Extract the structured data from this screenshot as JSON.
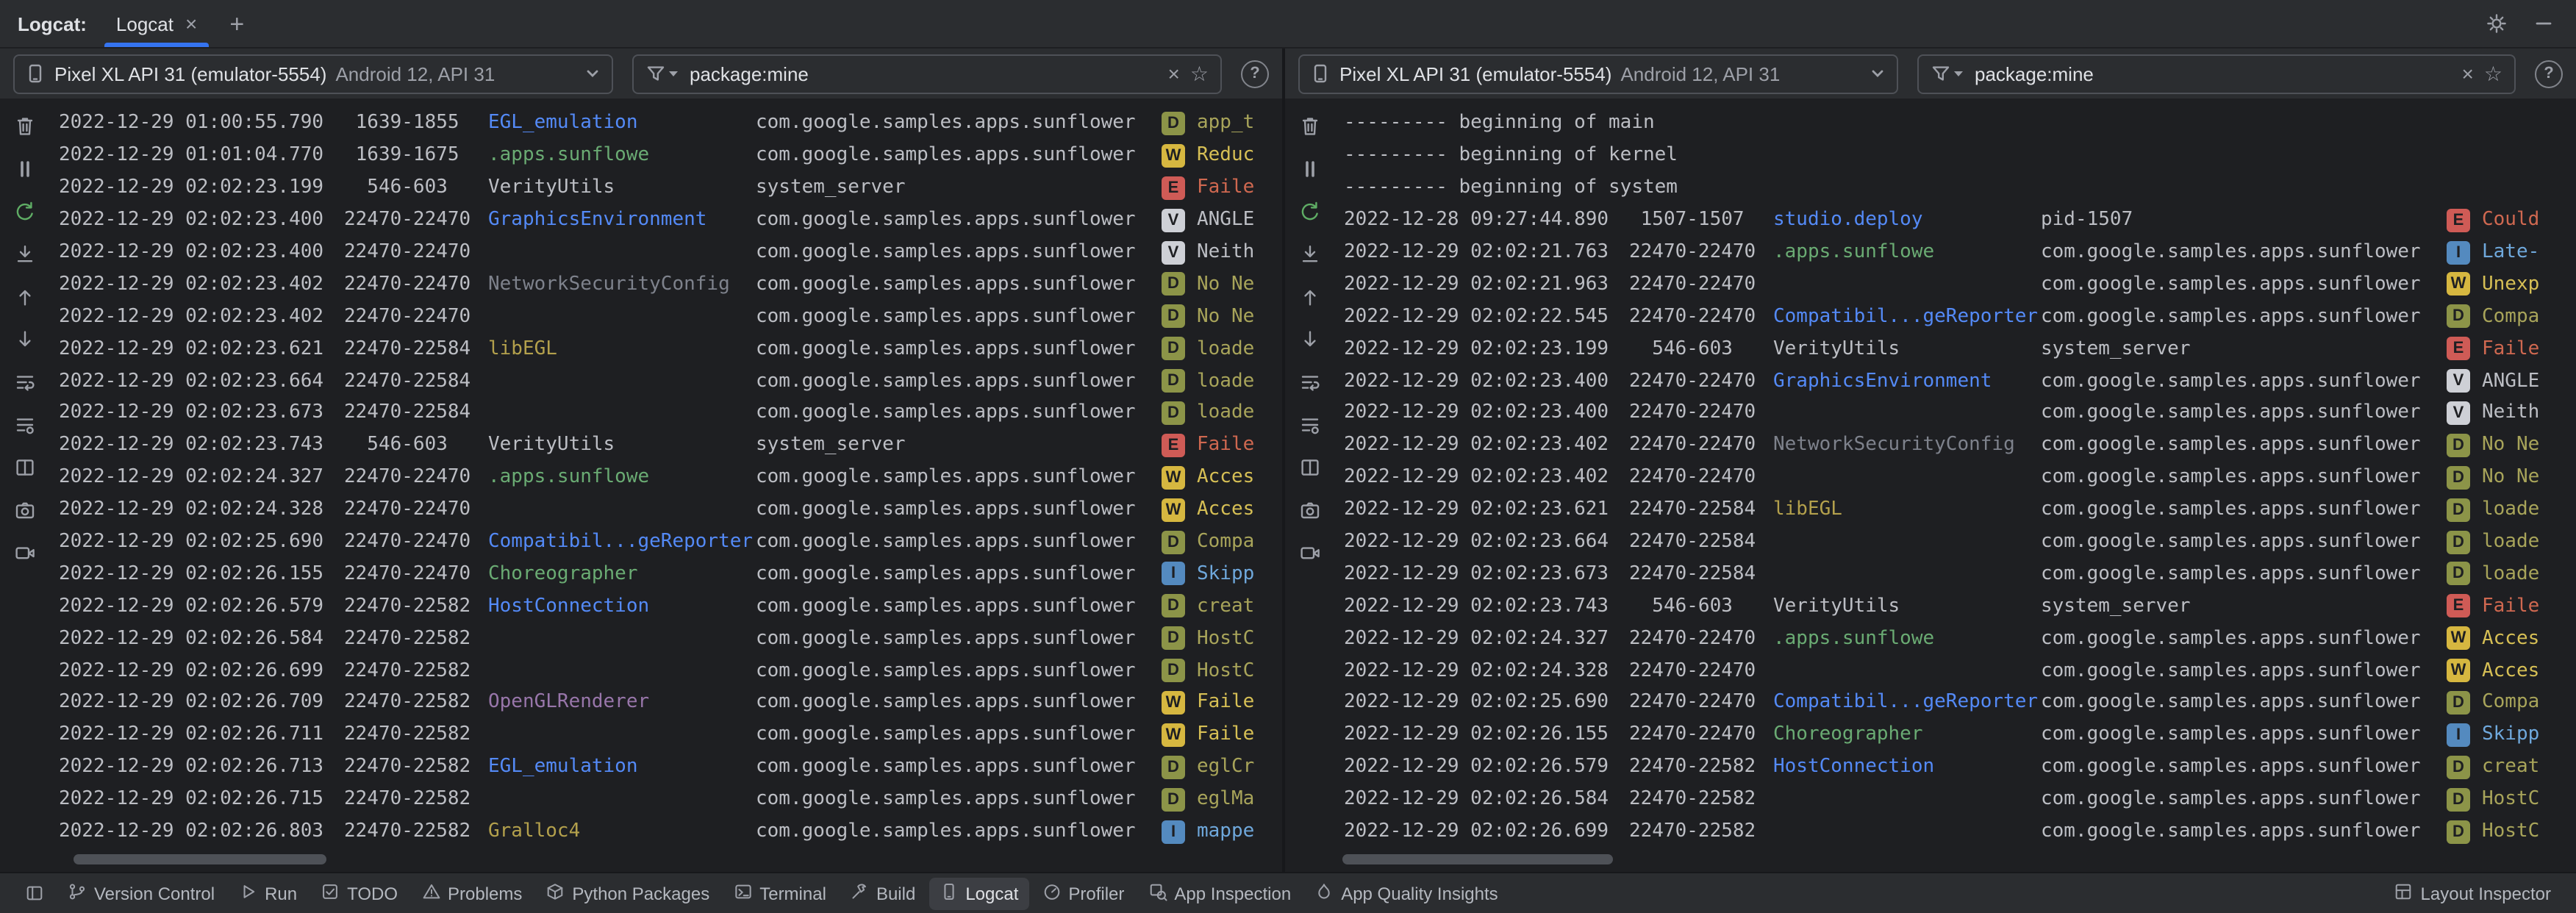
{
  "header": {
    "tool_label": "Logcat:",
    "tab_label": "Logcat",
    "close_glyph": "×",
    "add_glyph": "+",
    "right_icons": [
      "settings-gear",
      "hide-tool-window"
    ]
  },
  "controls": {
    "clear": "×",
    "favorite": "☆",
    "help": "?"
  },
  "palette": {
    "accent": "#3574F0",
    "chrome_bg": "#2B2D30",
    "content_bg": "#1E1F22",
    "levels": {
      "V": {
        "badge": "#CED0D6",
        "text": "#BCBEC4"
      },
      "D": {
        "badge": "#8C9448",
        "text": "#A8A45A"
      },
      "I": {
        "badge": "#548ABF",
        "text": "#6FA8DC"
      },
      "W": {
        "badge": "#D6B740",
        "text": "#D6BF55"
      },
      "E": {
        "badge": "#CF5B56",
        "text": "#CF6850"
      }
    },
    "tags": {
      "blue": "#548AF7",
      "green": "#6AAB73",
      "yellow": "#B3A04C",
      "gray": "#7E828C",
      "purple": "#9876AA",
      "default": "#BCBEC4"
    }
  },
  "side_toolbar": [
    "clear-logcat",
    "pause-logcat",
    "restart-logcat",
    "scroll-to-end",
    "previous-occurrence",
    "next-occurrence",
    "soft-wrap",
    "configure-logcat-options",
    "split-panels",
    "take-screenshot",
    "record-screen"
  ],
  "panes": [
    {
      "device_name": "Pixel XL API 31 (emulator-5554)",
      "device_detail": "Android 12, API 31",
      "filter": "package:mine",
      "rows": [
        {
          "t": "2022-12-29 01:00:55.790",
          "p": " 1639-1855",
          "tag": "EGL_emulation",
          "tc": "blue",
          "pkg": "com.google.samples.apps.sunflower",
          "l": "D",
          "m": "app_t"
        },
        {
          "t": "2022-12-29 01:01:04.770",
          "p": " 1639-1675",
          "tag": ".apps.sunflowe",
          "tc": "green",
          "pkg": "com.google.samples.apps.sunflower",
          "l": "W",
          "m": "Reduc"
        },
        {
          "t": "2022-12-29 02:02:23.199",
          "p": "  546-603",
          "tag": "VerityUtils",
          "tc": "default",
          "pkg": "system_server",
          "l": "E",
          "m": "Faile"
        },
        {
          "t": "2022-12-29 02:02:23.400",
          "p": "22470-22470",
          "tag": "GraphicsEnvironment",
          "tc": "blue",
          "pkg": "com.google.samples.apps.sunflower",
          "l": "V",
          "m": "ANGLE"
        },
        {
          "t": "2022-12-29 02:02:23.400",
          "p": "22470-22470",
          "tag": "",
          "tc": "default",
          "pkg": "com.google.samples.apps.sunflower",
          "l": "V",
          "m": "Neith"
        },
        {
          "t": "2022-12-29 02:02:23.402",
          "p": "22470-22470",
          "tag": "NetworkSecurityConfig",
          "tc": "gray",
          "pkg": "com.google.samples.apps.sunflower",
          "l": "D",
          "m": "No Ne"
        },
        {
          "t": "2022-12-29 02:02:23.402",
          "p": "22470-22470",
          "tag": "",
          "tc": "default",
          "pkg": "com.google.samples.apps.sunflower",
          "l": "D",
          "m": "No Ne"
        },
        {
          "t": "2022-12-29 02:02:23.621",
          "p": "22470-22584",
          "tag": "libEGL",
          "tc": "yellow",
          "pkg": "com.google.samples.apps.sunflower",
          "l": "D",
          "m": "loade"
        },
        {
          "t": "2022-12-29 02:02:23.664",
          "p": "22470-22584",
          "tag": "",
          "tc": "default",
          "pkg": "com.google.samples.apps.sunflower",
          "l": "D",
          "m": "loade"
        },
        {
          "t": "2022-12-29 02:02:23.673",
          "p": "22470-22584",
          "tag": "",
          "tc": "default",
          "pkg": "com.google.samples.apps.sunflower",
          "l": "D",
          "m": "loade"
        },
        {
          "t": "2022-12-29 02:02:23.743",
          "p": "  546-603",
          "tag": "VerityUtils",
          "tc": "default",
          "pkg": "system_server",
          "l": "E",
          "m": "Faile"
        },
        {
          "t": "2022-12-29 02:02:24.327",
          "p": "22470-22470",
          "tag": ".apps.sunflowe",
          "tc": "green",
          "pkg": "com.google.samples.apps.sunflower",
          "l": "W",
          "m": "Acces"
        },
        {
          "t": "2022-12-29 02:02:24.328",
          "p": "22470-22470",
          "tag": "",
          "tc": "default",
          "pkg": "com.google.samples.apps.sunflower",
          "l": "W",
          "m": "Acces"
        },
        {
          "t": "2022-12-29 02:02:25.690",
          "p": "22470-22470",
          "tag": "Compatibil...geReporter",
          "tc": "blue",
          "pkg": "com.google.samples.apps.sunflower",
          "l": "D",
          "m": "Compa"
        },
        {
          "t": "2022-12-29 02:02:26.155",
          "p": "22470-22470",
          "tag": "Choreographer",
          "tc": "green",
          "pkg": "com.google.samples.apps.sunflower",
          "l": "I",
          "m": "Skipp"
        },
        {
          "t": "2022-12-29 02:02:26.579",
          "p": "22470-22582",
          "tag": "HostConnection",
          "tc": "blue",
          "pkg": "com.google.samples.apps.sunflower",
          "l": "D",
          "m": "creat"
        },
        {
          "t": "2022-12-29 02:02:26.584",
          "p": "22470-22582",
          "tag": "",
          "tc": "default",
          "pkg": "com.google.samples.apps.sunflower",
          "l": "D",
          "m": "HostC"
        },
        {
          "t": "2022-12-29 02:02:26.699",
          "p": "22470-22582",
          "tag": "",
          "tc": "default",
          "pkg": "com.google.samples.apps.sunflower",
          "l": "D",
          "m": "HostC"
        },
        {
          "t": "2022-12-29 02:02:26.709",
          "p": "22470-22582",
          "tag": "OpenGLRenderer",
          "tc": "purple",
          "pkg": "com.google.samples.apps.sunflower",
          "l": "W",
          "m": "Faile"
        },
        {
          "t": "2022-12-29 02:02:26.711",
          "p": "22470-22582",
          "tag": "",
          "tc": "default",
          "pkg": "com.google.samples.apps.sunflower",
          "l": "W",
          "m": "Faile"
        },
        {
          "t": "2022-12-29 02:02:26.713",
          "p": "22470-22582",
          "tag": "EGL_emulation",
          "tc": "blue",
          "pkg": "com.google.samples.apps.sunflower",
          "l": "D",
          "m": "eglCr"
        },
        {
          "t": "2022-12-29 02:02:26.715",
          "p": "22470-22582",
          "tag": "",
          "tc": "default",
          "pkg": "com.google.samples.apps.sunflower",
          "l": "D",
          "m": "eglMa"
        },
        {
          "t": "2022-12-29 02:02:26.803",
          "p": "22470-22582",
          "tag": "Gralloc4",
          "tc": "yellow",
          "pkg": "com.google.samples.apps.sunflower",
          "l": "I",
          "m": "mappe"
        }
      ]
    },
    {
      "device_name": "Pixel XL API 31 (emulator-5554)",
      "device_detail": "Android 12, API 31",
      "filter": "package:mine",
      "rows": [
        {
          "sp": "--------- beginning of main"
        },
        {
          "sp": "--------- beginning of kernel"
        },
        {
          "sp": "--------- beginning of system"
        },
        {
          "t": "2022-12-28 09:27:44.890",
          "p": " 1507-1507",
          "tag": "studio.deploy",
          "tc": "blue",
          "pkg": "pid-1507",
          "l": "E",
          "m": "Could"
        },
        {
          "t": "2022-12-29 02:02:21.763",
          "p": "22470-22470",
          "tag": ".apps.sunflowe",
          "tc": "green",
          "pkg": "com.google.samples.apps.sunflower",
          "l": "I",
          "m": "Late-"
        },
        {
          "t": "2022-12-29 02:02:21.963",
          "p": "22470-22470",
          "tag": "",
          "tc": "default",
          "pkg": "com.google.samples.apps.sunflower",
          "l": "W",
          "m": "Unexp"
        },
        {
          "t": "2022-12-29 02:02:22.545",
          "p": "22470-22470",
          "tag": "Compatibil...geReporter",
          "tc": "blue",
          "pkg": "com.google.samples.apps.sunflower",
          "l": "D",
          "m": "Compa"
        },
        {
          "t": "2022-12-29 02:02:23.199",
          "p": "  546-603",
          "tag": "VerityUtils",
          "tc": "default",
          "pkg": "system_server",
          "l": "E",
          "m": "Faile"
        },
        {
          "t": "2022-12-29 02:02:23.400",
          "p": "22470-22470",
          "tag": "GraphicsEnvironment",
          "tc": "blue",
          "pkg": "com.google.samples.apps.sunflower",
          "l": "V",
          "m": "ANGLE"
        },
        {
          "t": "2022-12-29 02:02:23.400",
          "p": "22470-22470",
          "tag": "",
          "tc": "default",
          "pkg": "com.google.samples.apps.sunflower",
          "l": "V",
          "m": "Neith"
        },
        {
          "t": "2022-12-29 02:02:23.402",
          "p": "22470-22470",
          "tag": "NetworkSecurityConfig",
          "tc": "gray",
          "pkg": "com.google.samples.apps.sunflower",
          "l": "D",
          "m": "No Ne"
        },
        {
          "t": "2022-12-29 02:02:23.402",
          "p": "22470-22470",
          "tag": "",
          "tc": "default",
          "pkg": "com.google.samples.apps.sunflower",
          "l": "D",
          "m": "No Ne"
        },
        {
          "t": "2022-12-29 02:02:23.621",
          "p": "22470-22584",
          "tag": "libEGL",
          "tc": "yellow",
          "pkg": "com.google.samples.apps.sunflower",
          "l": "D",
          "m": "loade"
        },
        {
          "t": "2022-12-29 02:02:23.664",
          "p": "22470-22584",
          "tag": "",
          "tc": "default",
          "pkg": "com.google.samples.apps.sunflower",
          "l": "D",
          "m": "loade"
        },
        {
          "t": "2022-12-29 02:02:23.673",
          "p": "22470-22584",
          "tag": "",
          "tc": "default",
          "pkg": "com.google.samples.apps.sunflower",
          "l": "D",
          "m": "loade"
        },
        {
          "t": "2022-12-29 02:02:23.743",
          "p": "  546-603",
          "tag": "VerityUtils",
          "tc": "default",
          "pkg": "system_server",
          "l": "E",
          "m": "Faile"
        },
        {
          "t": "2022-12-29 02:02:24.327",
          "p": "22470-22470",
          "tag": ".apps.sunflowe",
          "tc": "green",
          "pkg": "com.google.samples.apps.sunflower",
          "l": "W",
          "m": "Acces"
        },
        {
          "t": "2022-12-29 02:02:24.328",
          "p": "22470-22470",
          "tag": "",
          "tc": "default",
          "pkg": "com.google.samples.apps.sunflower",
          "l": "W",
          "m": "Acces"
        },
        {
          "t": "2022-12-29 02:02:25.690",
          "p": "22470-22470",
          "tag": "Compatibil...geReporter",
          "tc": "blue",
          "pkg": "com.google.samples.apps.sunflower",
          "l": "D",
          "m": "Compa"
        },
        {
          "t": "2022-12-29 02:02:26.155",
          "p": "22470-22470",
          "tag": "Choreographer",
          "tc": "green",
          "pkg": "com.google.samples.apps.sunflower",
          "l": "I",
          "m": "Skipp"
        },
        {
          "t": "2022-12-29 02:02:26.579",
          "p": "22470-22582",
          "tag": "HostConnection",
          "tc": "blue",
          "pkg": "com.google.samples.apps.sunflower",
          "l": "D",
          "m": "creat"
        },
        {
          "t": "2022-12-29 02:02:26.584",
          "p": "22470-22582",
          "tag": "",
          "tc": "default",
          "pkg": "com.google.samples.apps.sunflower",
          "l": "D",
          "m": "HostC"
        },
        {
          "t": "2022-12-29 02:02:26.699",
          "p": "22470-22582",
          "tag": "",
          "tc": "default",
          "pkg": "com.google.samples.apps.sunflower",
          "l": "D",
          "m": "HostC"
        }
      ]
    }
  ],
  "statusbar": {
    "left": [
      "Version Control",
      "Run",
      "TODO",
      "Problems",
      "Python Packages",
      "Terminal",
      "Build",
      "Logcat",
      "Profiler",
      "App Inspection",
      "App Quality Insights"
    ],
    "right": [
      "Layout Inspector"
    ],
    "active": "Logcat"
  }
}
